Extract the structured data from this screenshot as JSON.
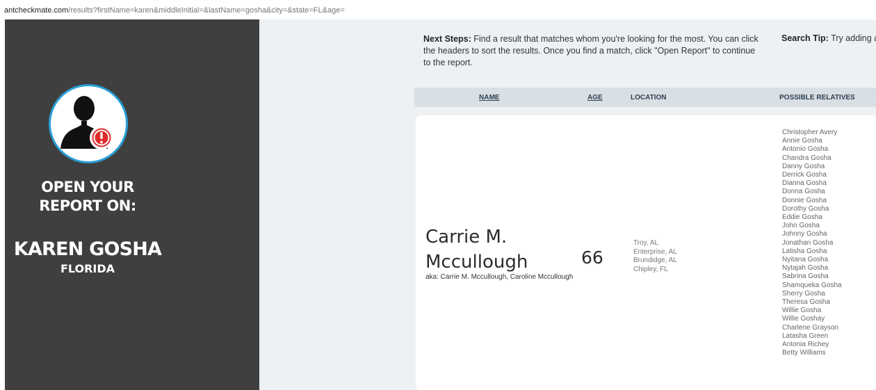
{
  "url": {
    "domain": "antcheckmate.com",
    "path": "/results?firstName=karen&middleInitial=&lastName=gosha&city=&state=FL&age="
  },
  "sidebar": {
    "open_line1": "OPEN YOUR",
    "open_line2": "REPORT ON:",
    "name": "KAREN GOSHA",
    "state": "FLORIDA"
  },
  "instructions": {
    "next_steps_label": "Next Steps:",
    "next_steps_text": " Find a result that matches whom you're looking for the most. You can click the headers to sort the results. Once you find a match, click \"Open Report\" to continue to the report.",
    "search_tip_label": "Search Tip:",
    "search_tip_text": " Try adding a r"
  },
  "table": {
    "headers": {
      "name": "NAME",
      "age": "AGE",
      "location": "LOCATION",
      "relatives": "POSSIBLE RELATIVES"
    }
  },
  "result": {
    "name_line1": "Carrie M.",
    "name_line2": "Mccullough",
    "aka": "aka: Carrie M. Mccullough, Caroline Mccullough",
    "age": "66",
    "locations": [
      "Troy, AL",
      "Enterprise, AL",
      "Brundidge, AL",
      "Chipley, FL"
    ],
    "relatives": [
      "Christopher Avery",
      "Annie Gosha",
      "Antonio Gosha",
      "Chandra Gosha",
      "Danny Gosha",
      "Derrick Gosha",
      "Dianna Gosha",
      "Donna Gosha",
      "Donnie Gosha",
      "Dorothy Gosha",
      "Eddie Gosha",
      "John Gosha",
      "Johnny Gosha",
      "Jonathan Gosha",
      "Latisha Gosha",
      "Nyitana Gosha",
      "Nytajah Gosha",
      "Sabrina Gosha",
      "Shamqueka Gosha",
      "Sherry Gosha",
      "Theresa Gosha",
      "Willie Gosha",
      "Willie Goshay",
      "Charlene Grayson",
      "Latasha Green",
      "Antonia Richey",
      "Betty Williams"
    ]
  },
  "icons": {
    "avatar": "person-silhouette-icon",
    "alert": "exclamation-badge-icon"
  },
  "colors": {
    "sidebar_bg": "#3f3f3f",
    "avatar_ring": "#2a9fd6",
    "alert_red": "#e02b2b",
    "header_bg": "#d8dfe5"
  }
}
